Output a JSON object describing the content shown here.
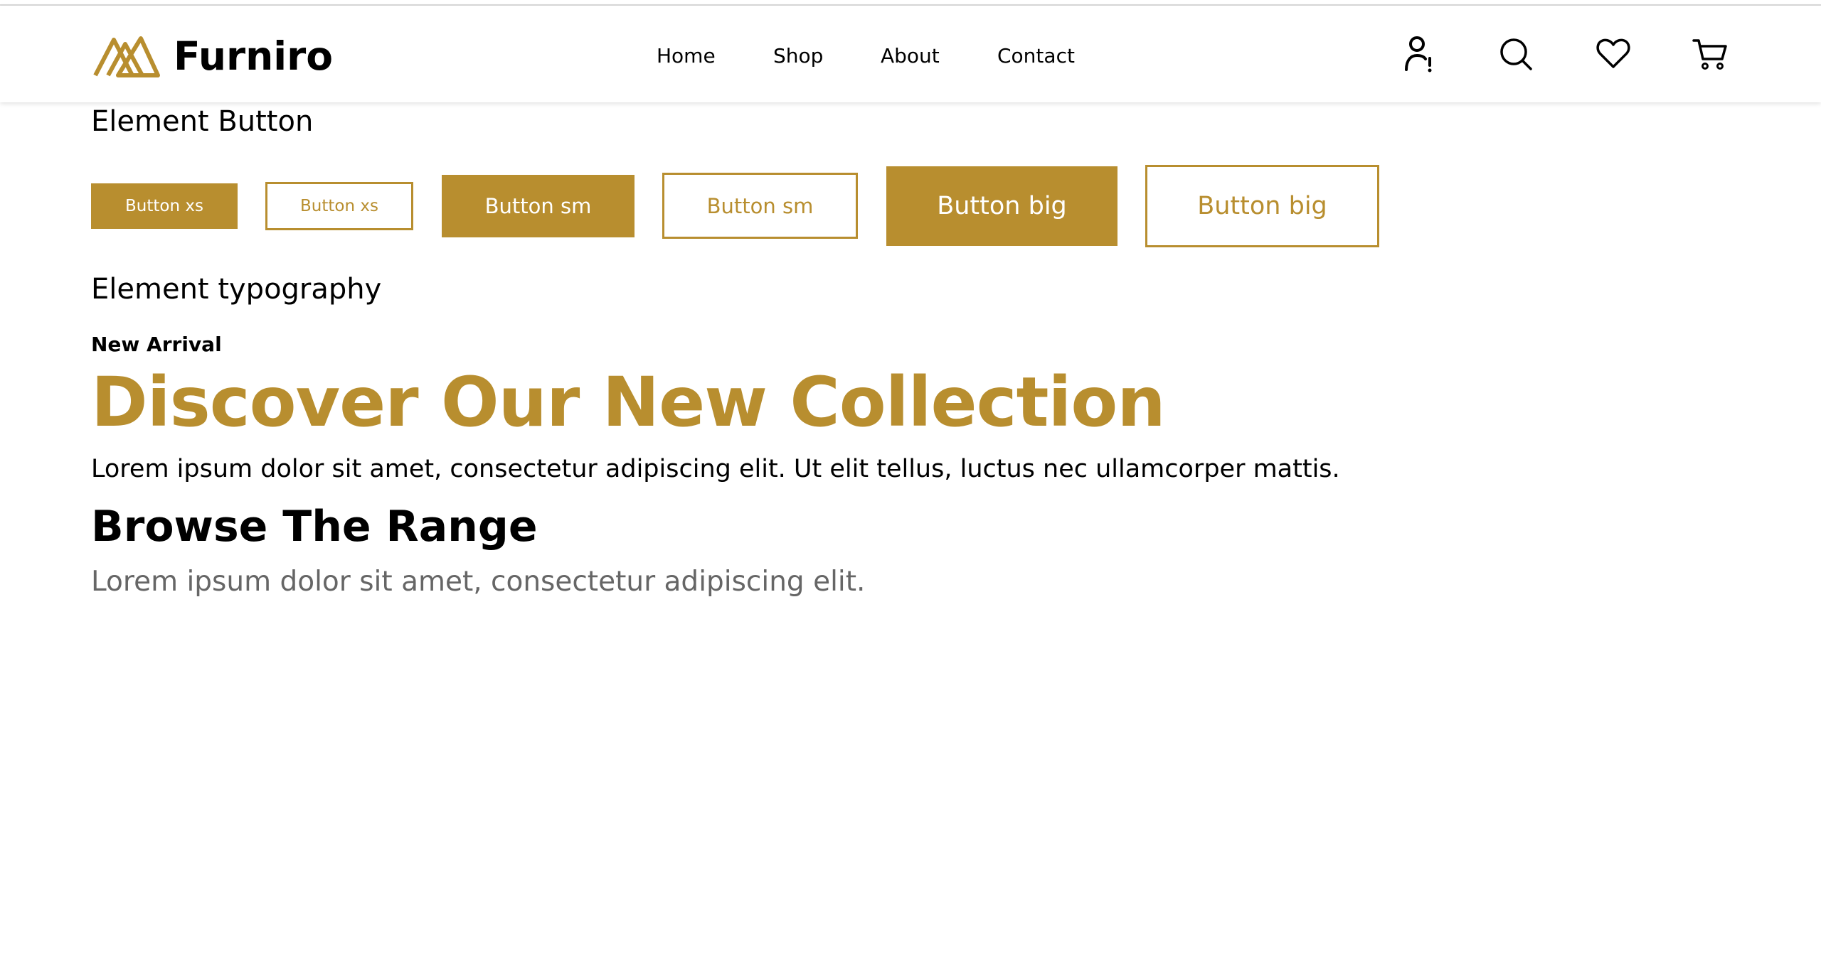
{
  "brand": {
    "name": "Furniro",
    "accent_color": "#B88E2F"
  },
  "nav": {
    "items": [
      {
        "label": "Home"
      },
      {
        "label": "Shop"
      },
      {
        "label": "About"
      },
      {
        "label": "Contact"
      }
    ]
  },
  "header_icons": [
    "user-alert-icon",
    "search-icon",
    "heart-icon",
    "cart-icon"
  ],
  "sections": {
    "buttons_title": "Element Button",
    "typography_title": "Element typography"
  },
  "buttons": [
    {
      "label": "Button xs",
      "variant": "solid",
      "size": "xs"
    },
    {
      "label": "Button xs",
      "variant": "outline",
      "size": "xs"
    },
    {
      "label": "Button sm",
      "variant": "solid",
      "size": "sm"
    },
    {
      "label": "Button sm",
      "variant": "outline",
      "size": "sm"
    },
    {
      "label": "Button big",
      "variant": "solid",
      "size": "big"
    },
    {
      "label": "Button big",
      "variant": "outline",
      "size": "big"
    }
  ],
  "typography": {
    "eyebrow": "New Arrival",
    "hero_title": "Discover Our New Collection",
    "hero_body": "Lorem ipsum dolor sit amet, consectetur adipiscing elit. Ut elit tellus, luctus nec ullamcorper mattis.",
    "range_title": "Browse The Range",
    "range_subtitle": "Lorem ipsum dolor sit amet, consectetur adipiscing elit."
  },
  "colors": {
    "text": "#000000",
    "muted_text": "#666666",
    "background": "#FFFFFF"
  }
}
